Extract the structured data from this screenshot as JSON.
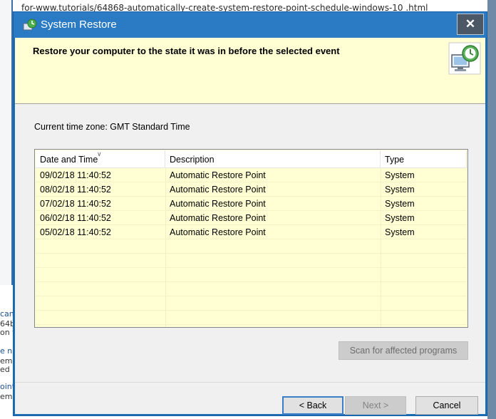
{
  "background": {
    "top_text": "for-www.tutorials/64868-automatically-create-system-restore-point-schedule-windows-10 .html",
    "snippets": [
      "can",
      "64b",
      "on t",
      "e n",
      "em",
      "ed a",
      "oint",
      "em"
    ]
  },
  "window": {
    "title": "System Restore",
    "close_glyph": "✕"
  },
  "banner": {
    "heading": "Restore your computer to the state it was in before the selected event"
  },
  "timezone_label": "Current time zone: GMT Standard Time",
  "table": {
    "columns": [
      "Date and Time",
      "Description",
      "Type"
    ],
    "rows": [
      [
        "09/02/18 11:40:52",
        "Automatic Restore Point",
        "System"
      ],
      [
        "08/02/18 11:40:52",
        "Automatic Restore Point",
        "System"
      ],
      [
        "07/02/18 11:40:52",
        "Automatic Restore Point",
        "System"
      ],
      [
        "06/02/18 11:40:52",
        "Automatic Restore Point",
        "System"
      ],
      [
        "05/02/18 11:40:52",
        "Automatic Restore Point",
        "System"
      ]
    ]
  },
  "buttons": {
    "scan": "Scan for affected programs",
    "back": "< Back",
    "next": "Next >",
    "cancel": "Cancel"
  },
  "colors": {
    "title_bar": "#2a7bc3",
    "banner": "#ffffd3",
    "focus_border": "#3d7cc9"
  }
}
